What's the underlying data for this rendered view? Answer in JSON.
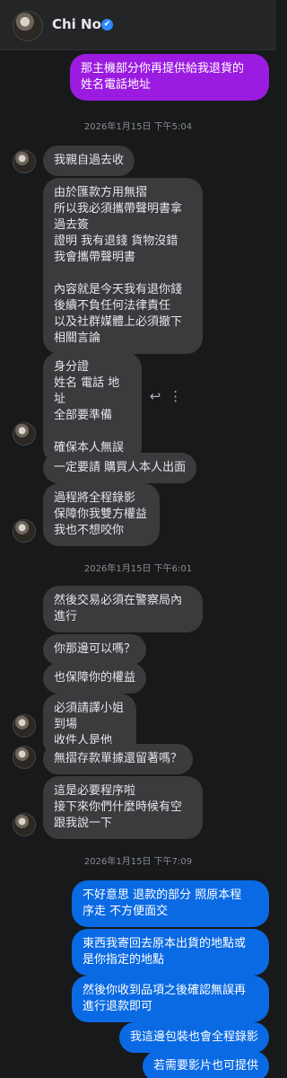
{
  "header": {
    "contact_name": "Chi No",
    "verified": "✔"
  },
  "timestamps": [
    "2026年1月15日 下午5:04",
    "2026年1月15日 下午6:01",
    "2026年1月15日 下午7:09"
  ],
  "messages": {
    "m0": "那主機部分你再提供給我退貨的\n姓名電話地址",
    "m1": "我親自過去收",
    "m2": "由於匯款方用無摺\n所以我必須攜帶聲明書拿\n過去簽\n證明  我有退錢  貨物沒錯\n我會攜帶聲明書\n\n內容就是今天我有退你錢\n後續不負任何法律責任\n以及社群媒體上必須撤下\n相關言論",
    "m3": "身分證\n姓名 電話 地址\n全部要準備\n\n確保本人無誤",
    "m4": "一定要請 購買人本人出面",
    "m5": "過程將全程錄影\n保障你我雙方權益\n我也不想咬你",
    "m6": "然後交易必須在警察局內\n進行",
    "m7": "你那邊可以嗎？",
    "m8": "也保障你的權益",
    "m9": "必須請譯小姐到場\n收件人是他",
    "m10": "無摺存款單據還留著嗎？",
    "m11": "這是必要程序啦\n接下來你們什麼時候有空\n跟我說一下",
    "m12": "不好意思 退款的部分 照原本程\n序走 不方便面交",
    "m13": "東西我寄回去原本出貨的地點或\n是你指定的地點",
    "m14": "然後你收到品項之後確認無誤再\n進行退款即可",
    "m15": "我這邊包裝也會全程錄影",
    "m16": "若需要影片也可提供"
  },
  "icons": {
    "reply": "↩",
    "more": "⋮"
  },
  "colors": {
    "incoming": "#3a3b3c",
    "outgoing": "#0a6ae3",
    "outgoing_highlight": "#9b1be0",
    "background": "#18191a"
  }
}
